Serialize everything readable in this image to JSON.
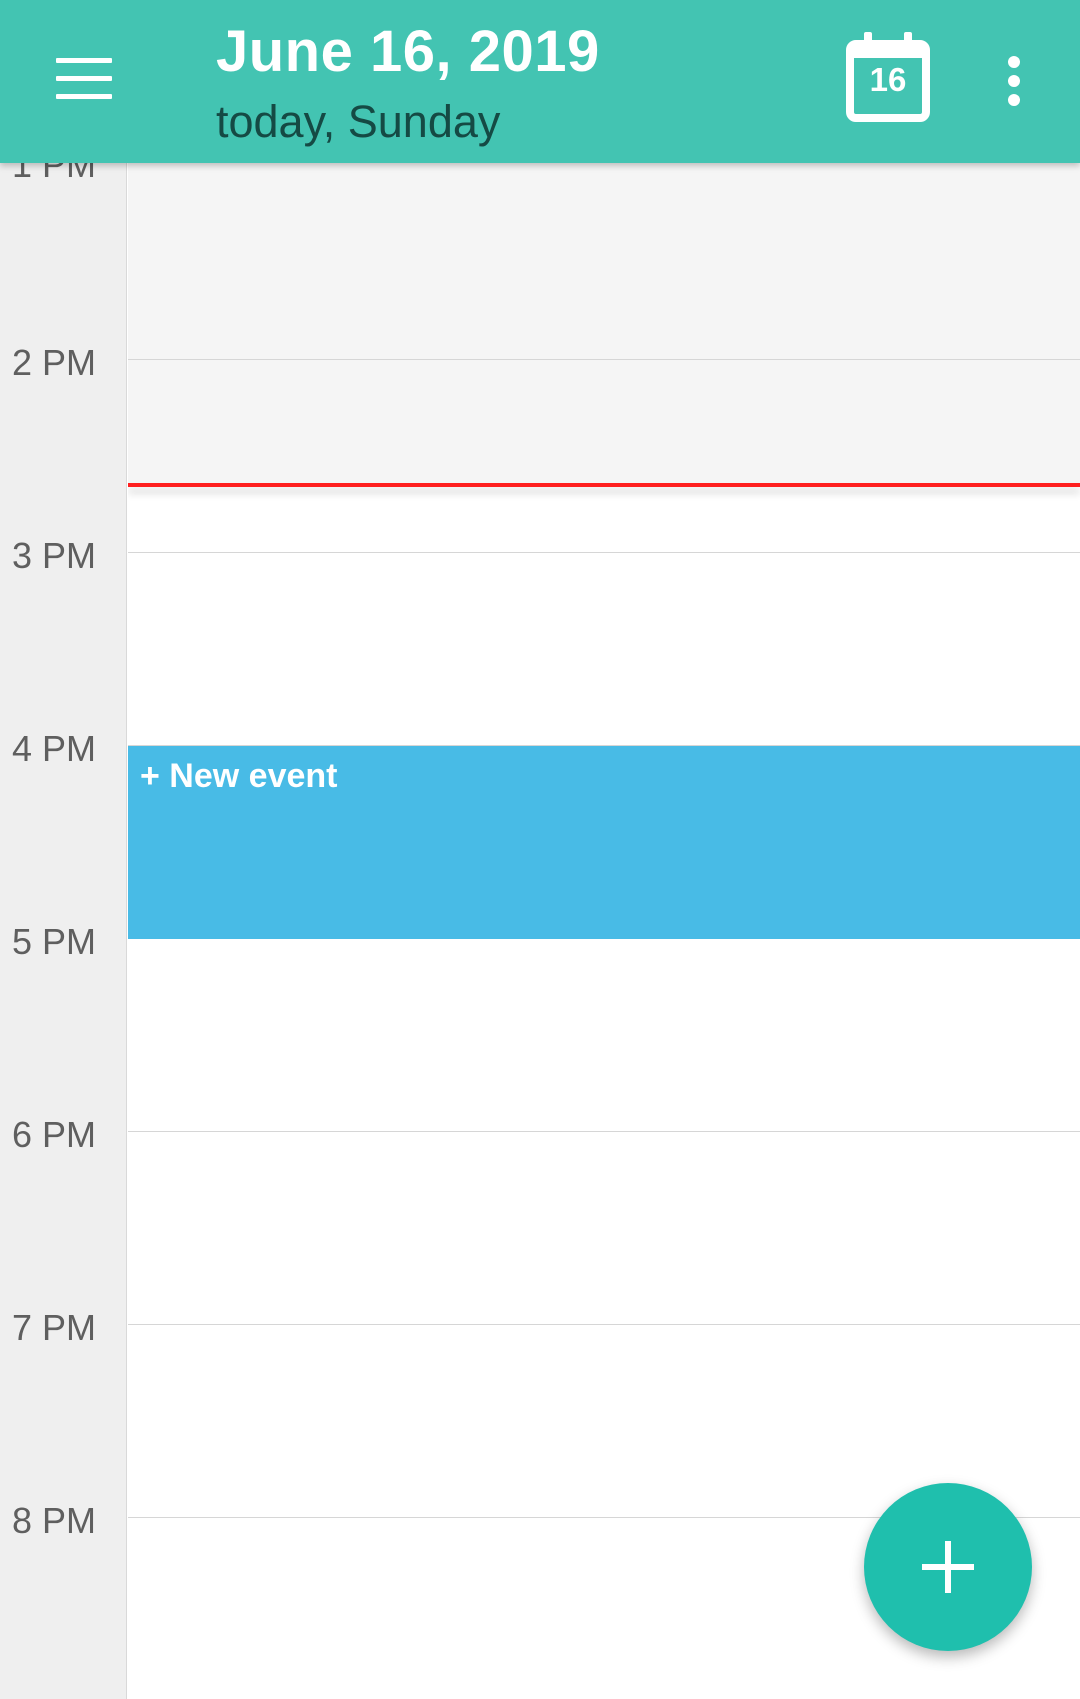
{
  "header": {
    "title": "June 16, 2019",
    "subtitle": "today, Sunday",
    "today_day_number": "16",
    "background_color": "#43c4b2",
    "icons": {
      "menu": "hamburger-menu-icon",
      "today": "calendar-today-icon",
      "more": "more-vertical-icon"
    }
  },
  "timeline": {
    "hours": [
      "1 PM",
      "2 PM",
      "3 PM",
      "4 PM",
      "5 PM",
      "6 PM",
      "7 PM",
      "8 PM"
    ],
    "current_time_indicator_color": "#ff1f1f"
  },
  "events": [
    {
      "label": "+ New event",
      "color": "#48bbe6"
    }
  ],
  "fab": {
    "icon": "plus-icon",
    "color": "#1fbfad"
  }
}
